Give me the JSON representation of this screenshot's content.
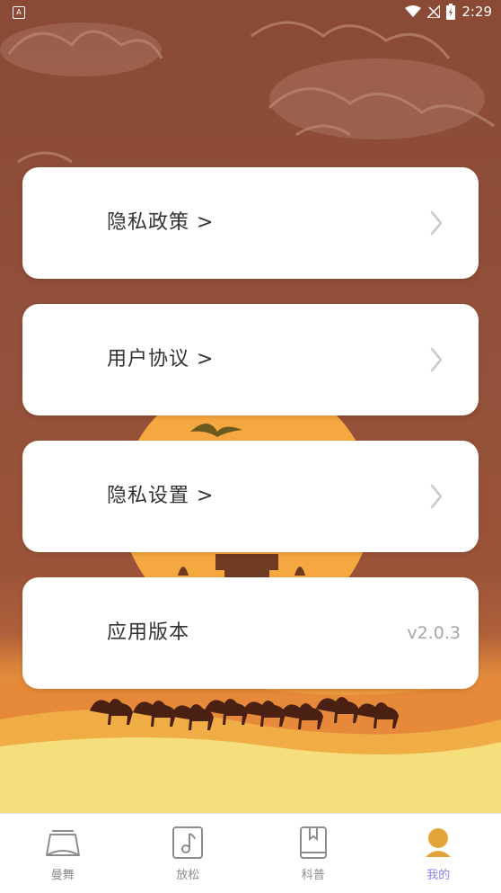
{
  "status_bar": {
    "time": "2:29",
    "icons": [
      "notification-a-icon",
      "wifi-icon",
      "signal-icon",
      "battery-charging-icon"
    ]
  },
  "menu": [
    {
      "label": "隐私政策 >",
      "trailing": "chevron-right-icon"
    },
    {
      "label": "用户协议 >",
      "trailing": "chevron-right-icon"
    },
    {
      "label": "隐私设置 >",
      "trailing": "chevron-right-icon"
    },
    {
      "label": "应用版本",
      "value": "v2.0.3"
    }
  ],
  "bottom_nav": {
    "active_index": 3,
    "active_color": "#8a86f0",
    "tabs": [
      {
        "label": "曼舞",
        "icon": "dance-stage-icon"
      },
      {
        "label": "放松",
        "icon": "music-note-icon"
      },
      {
        "label": "科普",
        "icon": "book-icon"
      },
      {
        "label": "我的",
        "icon": "user-avatar-icon"
      }
    ]
  }
}
